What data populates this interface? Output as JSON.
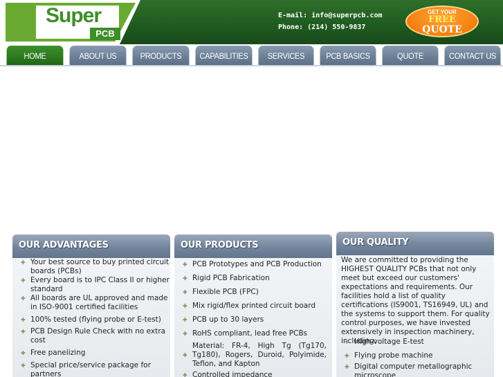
{
  "header": {
    "logo": {
      "name": "Super",
      "sub": "PCB"
    },
    "email_label": "E-mail:",
    "email": "info@superpcb.com",
    "phone_label": "Phone:",
    "phone": "(214) 550-9837",
    "quote_badge": {
      "line1": "GET YOUR",
      "line2": "FREE",
      "line3": "QUOTE"
    }
  },
  "nav": {
    "tabs": [
      {
        "label": "HOME",
        "active": true
      },
      {
        "label": "ABOUT US",
        "active": false
      },
      {
        "label": "PRODUCTS",
        "active": false
      },
      {
        "label": "CAPABILITIES",
        "active": false
      },
      {
        "label": "SERVICES",
        "active": false
      },
      {
        "label": "PCB BASICS",
        "active": false
      },
      {
        "label": "QUOTE",
        "active": false
      },
      {
        "label": "CONTACT US",
        "active": false
      }
    ]
  },
  "advantages": {
    "title": "OUR ADVANTAGES",
    "items": [
      "Your best source to buy printed circuit boards (PCBs)",
      "Every board is to IPC Class II or higher standard",
      "All boards are UL approved and made in ISO-9001 certified facilities",
      "100% tested (flying probe or E-test)",
      "PCB Design Rule Check with no extra cost",
      "Free panelizing",
      "Special price/service package for partners"
    ]
  },
  "products": {
    "title": "OUR PRODUCTS",
    "items": [
      "PCB Prototypes and PCB Production",
      "Rigid PCB Fabrication",
      "Flexible PCB (FPC)",
      "Mix rigid/flex printed circuit board",
      "PCB up to 30 layers",
      "RoHS compliant, lead free PCBs",
      "Material: FR-4, High Tg (Tg170, Tg180), Rogers, Duroid, Polyimide, Teflon, and Kapton",
      "Controlled impedance"
    ]
  },
  "quality": {
    "title": "OUR QUALITY",
    "paragraph": "We are committed to providing the HIGHEST QUALITY PCBs that not only meet but exceed our customers' expectations and requirements. Our facilities hold a list of quality certifications (IS9001, TS16949, UL) and the systems to support them. For quality control purposes, we have invested extensively in inspection machinery, including:",
    "items": [
      "High-voltage E-test",
      "Flying probe machine",
      "Digital computer metallographic microscope"
    ]
  },
  "colors": {
    "header_green": "#2f6f2a",
    "nav_gray": "#74859c",
    "accent_orange": "#f57f11"
  }
}
